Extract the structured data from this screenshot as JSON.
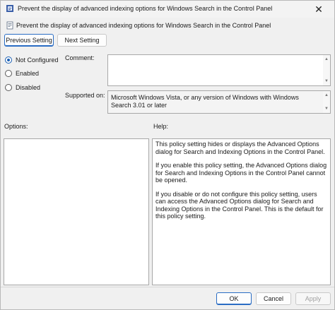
{
  "window": {
    "title": "Prevent the display of advanced indexing options for Windows Search in the Control Panel",
    "close_glyph": "✕"
  },
  "header": {
    "policy_name": "Prevent the display of advanced indexing options for Windows Search in the Control Panel"
  },
  "nav": {
    "previous_label": "Previous Setting",
    "next_label": "Next Setting"
  },
  "state": {
    "options": [
      {
        "label": "Not Configured",
        "checked": true
      },
      {
        "label": "Enabled",
        "checked": false
      },
      {
        "label": "Disabled",
        "checked": false
      }
    ]
  },
  "comment": {
    "label": "Comment:",
    "value": ""
  },
  "supported": {
    "label": "Supported on:",
    "value": "Microsoft Windows Vista, or any version of Windows with Windows Search 3.01 or later"
  },
  "options_panel": {
    "label": "Options:"
  },
  "help_panel": {
    "label": "Help:",
    "paragraphs": [
      "This policy setting hides or displays the Advanced Options dialog for Search and Indexing Options in the Control Panel.",
      "If you enable this policy setting, the Advanced Options dialog for Search and Indexing Options in the Control Panel cannot be opened.",
      "If you disable or do not configure this policy setting, users can access the Advanced Options dialog for Search and Indexing Options in the Control Panel. This is the default for this policy setting."
    ]
  },
  "footer": {
    "ok_label": "OK",
    "cancel_label": "Cancel",
    "apply_label": "Apply"
  },
  "icons": {
    "title": "policy-setting-icon",
    "subheader": "policy-document-icon"
  },
  "colors": {
    "accent": "#1a5fb4",
    "background": "#f0f0f0"
  }
}
